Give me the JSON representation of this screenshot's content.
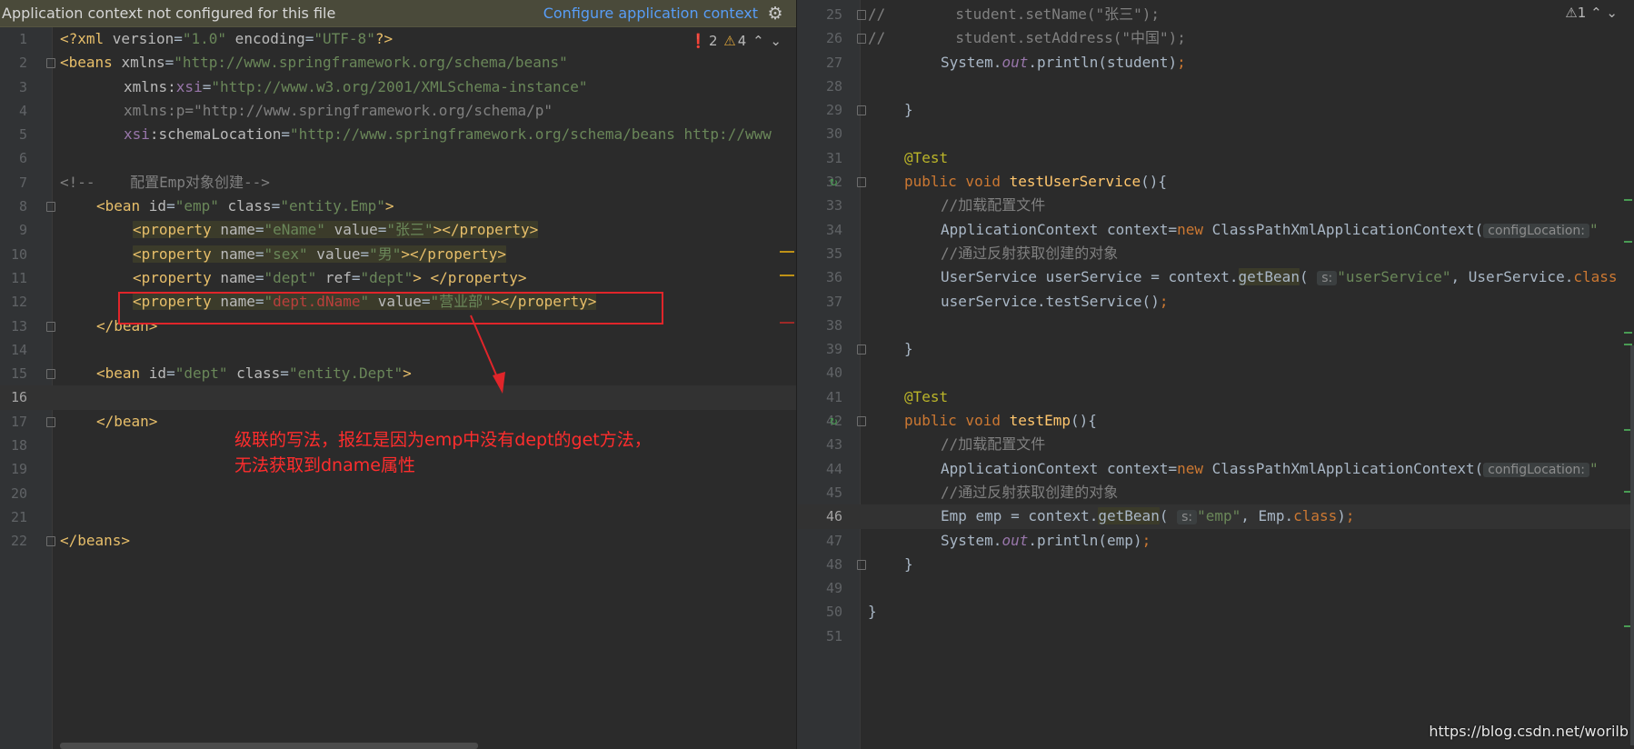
{
  "banner": {
    "message": "Application context not configured for this file",
    "link": "Configure application context",
    "gear_icon": "gear-icon"
  },
  "left_indicators": {
    "errors": "2",
    "warnings": "4"
  },
  "right_indicators": {
    "warnings": "1"
  },
  "left_lines": [
    {
      "n": "1"
    },
    {
      "n": "2"
    },
    {
      "n": "3"
    },
    {
      "n": "4"
    },
    {
      "n": "5"
    },
    {
      "n": "6"
    },
    {
      "n": "7"
    },
    {
      "n": "8"
    },
    {
      "n": "9"
    },
    {
      "n": "10"
    },
    {
      "n": "11"
    },
    {
      "n": "12"
    },
    {
      "n": "13"
    },
    {
      "n": "14"
    },
    {
      "n": "15"
    },
    {
      "n": "16"
    },
    {
      "n": "17"
    },
    {
      "n": "18"
    },
    {
      "n": "19"
    },
    {
      "n": "20"
    },
    {
      "n": "21"
    },
    {
      "n": "22"
    }
  ],
  "xml": {
    "l1": {
      "a": "<?xml ",
      "b": "version",
      "c": "=",
      "d": "\"1.0\"",
      "e": " encoding",
      "f": "=",
      "g": "\"UTF-8\"",
      "h": "?>"
    },
    "l2": {
      "a": "<beans ",
      "b": "xmlns",
      "c": "=",
      "d": "\"http://www.springframework.org/schema/beans\""
    },
    "l3": {
      "a": "xmlns:",
      "b": "xsi",
      "c": "=",
      "d": "\"http://www.w3.org/2001/XMLSchema-instance\""
    },
    "l4": {
      "a": "xmlns:p=\"http://www.springframework.org/schema/p\""
    },
    "l5": {
      "a": "xsi",
      "b": ":schemaLocation",
      "c": "=",
      "d": "\"http://www.springframework.org/schema/beans http://www"
    },
    "l7": {
      "a": "<!--    配置Emp对象创建-->"
    },
    "l8": {
      "a": "<bean ",
      "b": "id",
      "c": "=",
      "d": "\"emp\"",
      "e": " class",
      "f": "=",
      "g": "\"entity.Emp\"",
      "h": ">"
    },
    "l9": {
      "a": "<property ",
      "b": "name",
      "c": "=",
      "d": "\"eName\"",
      "e": " value",
      "f": "=",
      "g": "\"张三\"",
      "h": "></property>"
    },
    "l10": {
      "a": "<property ",
      "b": "name",
      "c": "=",
      "d": "\"sex\"",
      "e": " value",
      "f": "=",
      "g": "\"男\"",
      "h": "></property>"
    },
    "l11": {
      "a": "<property ",
      "b": "name",
      "c": "=",
      "d": "\"dept\"",
      "e": " ref",
      "f": "=",
      "g": "\"dept\"",
      "h": "> </property>"
    },
    "l12": {
      "a": "<property ",
      "b": "name",
      "c": "=",
      "d": "\"",
      "d2": "dept.dName",
      "d3": "\"",
      "e": " value",
      "f": "=",
      "g": "\"营业部\"",
      "h": "></property>"
    },
    "l13": {
      "a": "</bean>"
    },
    "l15": {
      "a": "<bean ",
      "b": "id",
      "c": "=",
      "d": "\"dept\"",
      "e": " class",
      "f": "=",
      "g": "\"entity.Dept\"",
      "h": ">"
    },
    "l17": {
      "a": "</bean>"
    },
    "l22": {
      "a": "</beans>"
    }
  },
  "annotation": {
    "line1": "级联的写法，报红是因为emp中没有dept的get方法，",
    "line2": "无法获取到dname属性"
  },
  "java": {
    "l25": {
      "a": "//",
      "b": "        student.setName(\"张三\");"
    },
    "l26": {
      "a": "//",
      "b": "        student.setAddress(\"中国\");"
    },
    "l27": {
      "a": "System.",
      "b": "out",
      "c": ".println(student)",
      "d": ";"
    },
    "l29": {
      "a": "}"
    },
    "l31": {
      "a": "@Test"
    },
    "l32": {
      "a": "public void ",
      "b": "testUserService",
      "c": "(){"
    },
    "l33": {
      "a": "//加载配置文件"
    },
    "l34": {
      "a": "ApplicationContext context=",
      "b": "new ",
      "c": "ClassPathXmlApplicationContext(",
      "hint": "configLocation:",
      "d": "\""
    },
    "l35": {
      "a": "//通过反射获取创建的对象"
    },
    "l36": {
      "a": "UserService userService = context.",
      "b": "getBean",
      "c": "( ",
      "hint": "s:",
      "d": "\"userService\"",
      "e": ", UserService.",
      "f": "class"
    },
    "l37": {
      "a": "userService.testService()",
      "b": ";"
    },
    "l39": {
      "a": "}"
    },
    "l41": {
      "a": "@Test"
    },
    "l42": {
      "a": "public void ",
      "b": "testEmp",
      "c": "(){"
    },
    "l43": {
      "a": "//加载配置文件"
    },
    "l44": {
      "a": "ApplicationContext context=",
      "b": "new ",
      "c": "ClassPathXmlApplicationContext(",
      "hint": "configLocation:",
      "d": "\""
    },
    "l45": {
      "a": "//通过反射获取创建的对象"
    },
    "l46": {
      "a": "Emp emp = context.",
      "b": "getBean",
      "c": "( ",
      "hint": "s:",
      "d": "\"emp\"",
      "e": ", Emp.",
      "f": "class",
      "g": ")",
      "h": ";"
    },
    "l47": {
      "a": "System.",
      "b": "out",
      "c": ".println(emp)",
      "d": ";"
    },
    "l48": {
      "a": "}"
    },
    "l50": {
      "a": "}"
    }
  },
  "right_lines": [
    {
      "n": "25"
    },
    {
      "n": "26"
    },
    {
      "n": "27"
    },
    {
      "n": "28"
    },
    {
      "n": "29"
    },
    {
      "n": "30"
    },
    {
      "n": "31"
    },
    {
      "n": "32"
    },
    {
      "n": "33"
    },
    {
      "n": "34"
    },
    {
      "n": "35"
    },
    {
      "n": "36"
    },
    {
      "n": "37"
    },
    {
      "n": "38"
    },
    {
      "n": "39"
    },
    {
      "n": "40"
    },
    {
      "n": "41"
    },
    {
      "n": "42"
    },
    {
      "n": "43"
    },
    {
      "n": "44"
    },
    {
      "n": "45"
    },
    {
      "n": "46"
    },
    {
      "n": "47"
    },
    {
      "n": "48"
    },
    {
      "n": "49"
    },
    {
      "n": "50"
    },
    {
      "n": "51"
    }
  ],
  "watermark": "https://blog.csdn.net/worilb",
  "colors": {
    "error_box": "#e0252a",
    "annotation": "#ff2d2d",
    "link": "#589df6",
    "banner_bg": "#4a4a3a"
  }
}
